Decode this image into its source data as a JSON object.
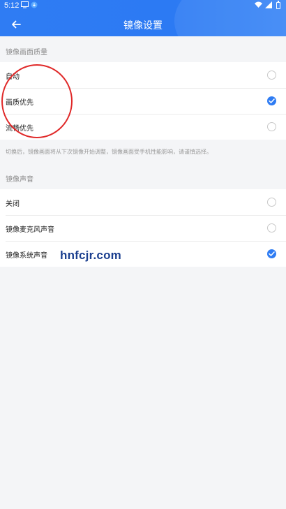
{
  "status_bar": {
    "time": "5:12",
    "icons": [
      "screen-icon",
      "download-icon",
      "wifi-icon",
      "signal-icon",
      "battery-icon"
    ]
  },
  "header": {
    "title": "镜像设置",
    "back_icon": "arrow-left-icon"
  },
  "colors": {
    "accent": "#2f7cf3",
    "annotation": "#e02a2a",
    "watermark": "#1b3f8f"
  },
  "quality": {
    "section_label": "镜像画面质量",
    "options": [
      {
        "label": "自动",
        "checked": false
      },
      {
        "label": "画质优先",
        "checked": true
      },
      {
        "label": "流畅优先",
        "checked": false
      }
    ],
    "note": "切换后，镜像画面将从下次镜像开始调整，镜像画面受手机性能影响，请谨慎选择。"
  },
  "sound": {
    "section_label": "镜像声音",
    "options": [
      {
        "label": "关闭",
        "checked": false
      },
      {
        "label": "镜像麦克风声音",
        "checked": false
      },
      {
        "label": "镜像系统声音",
        "checked": true
      }
    ]
  },
  "watermark": "hnfcjr.com"
}
